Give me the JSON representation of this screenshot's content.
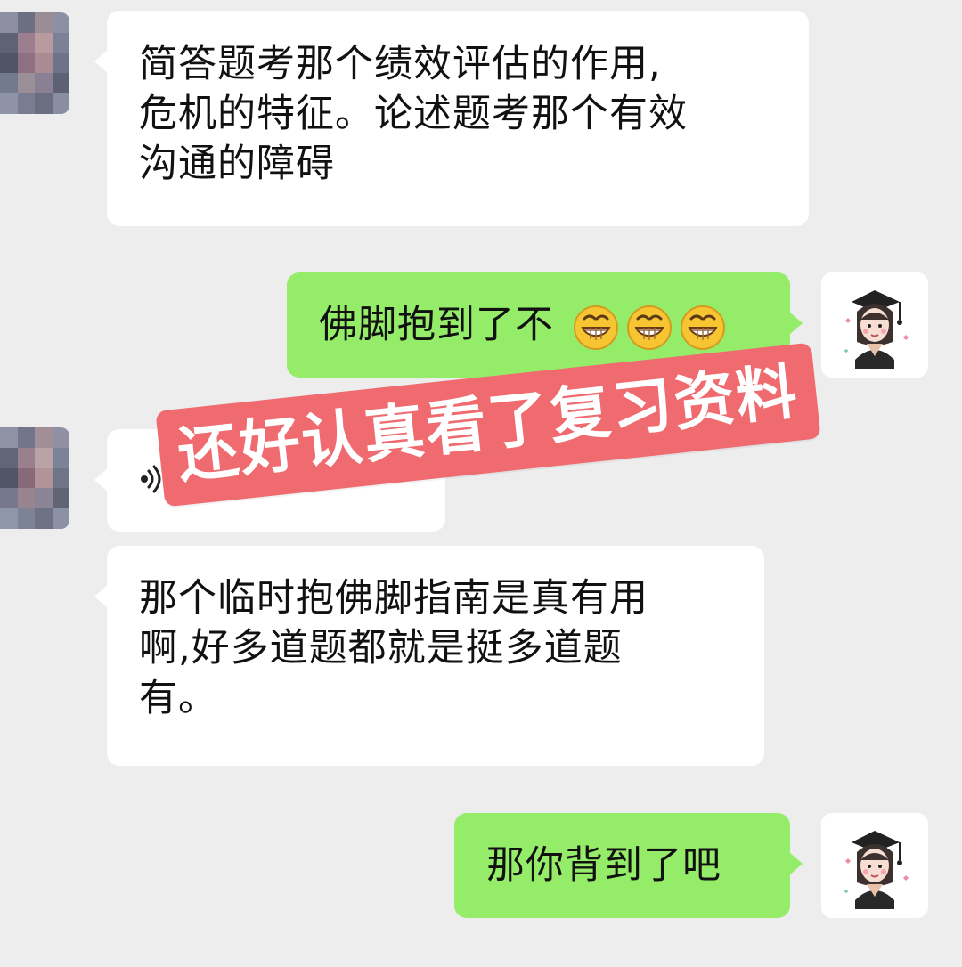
{
  "chat": {
    "messages": [
      {
        "side": "incoming",
        "lines": [
          "简答题考那个绩效评估的作用,",
          "危机的特征。论述题考那个有效",
          "沟通的障碍"
        ]
      },
      {
        "side": "outgoing",
        "text": "佛脚抱到了不",
        "emoji": [
          "grinning-face",
          "grinning-face",
          "grinning-face"
        ]
      },
      {
        "side": "incoming",
        "kind": "voice",
        "icon": "voice-icon"
      },
      {
        "side": "incoming",
        "lines": [
          "那个临时抱佛脚指南是真有用",
          "啊,好多道题都就是挺多道题",
          "有。"
        ]
      },
      {
        "side": "outgoing",
        "text": "那你背到了吧"
      }
    ]
  },
  "overlay": {
    "text": "还好认真看了复习资料",
    "background": "#ef6b70"
  },
  "colors": {
    "background": "#ededed",
    "incoming_bubble": "#ffffff",
    "outgoing_bubble": "#95ec69",
    "text": "#111111"
  },
  "icons": {
    "incoming_avatar": "pixelated-avatar-icon",
    "outgoing_avatar": "graduate-girl-avatar-icon",
    "emoji": "grinning-face-emoji"
  }
}
